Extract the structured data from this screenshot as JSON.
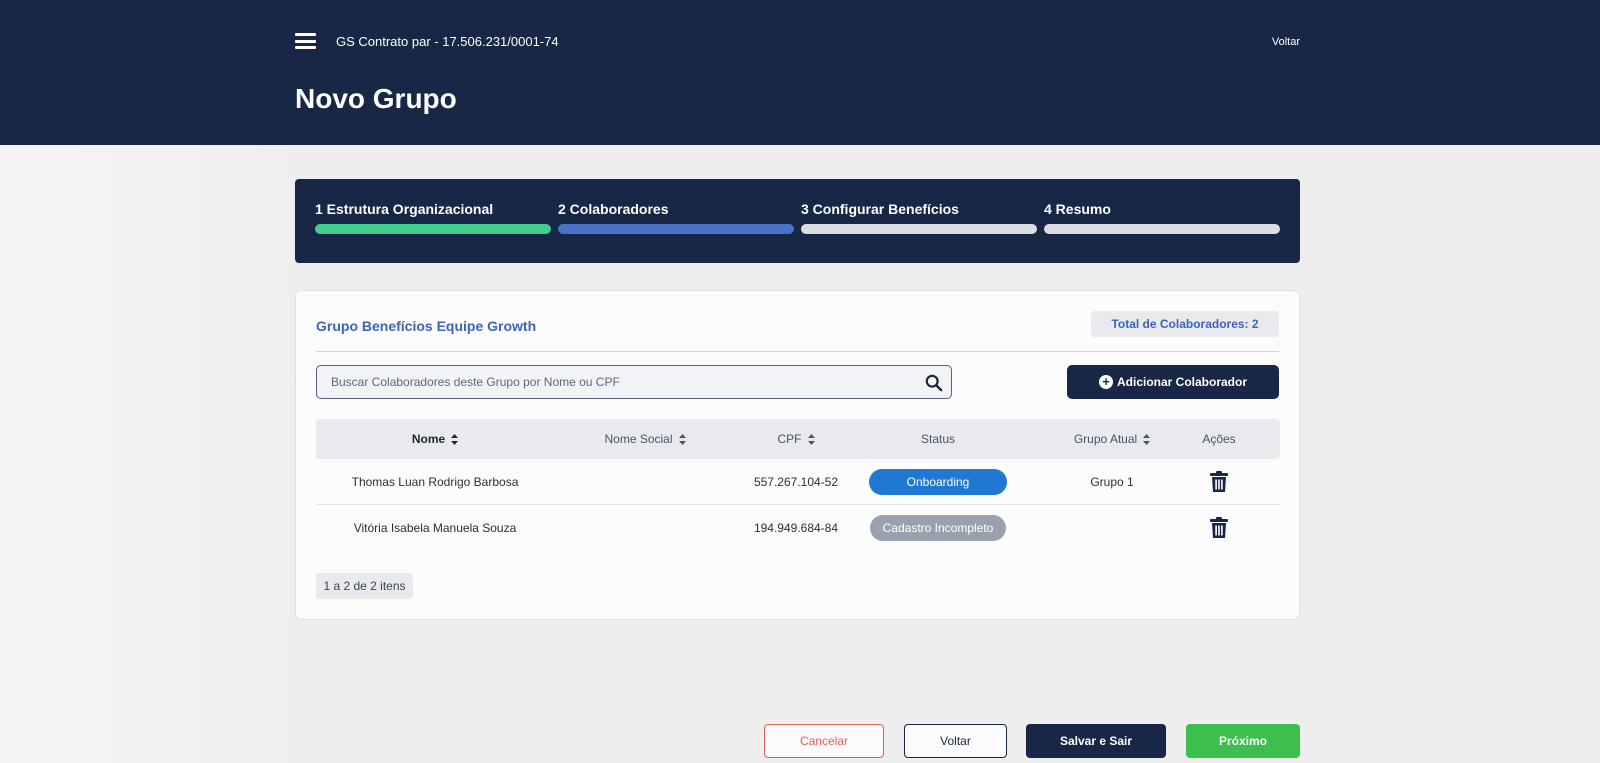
{
  "header": {
    "company": "GS Contrato par  -  17.506.231/0001-74",
    "back_link": "Voltar",
    "title": "Novo Grupo"
  },
  "stepper": {
    "steps": [
      {
        "label": "1 Estrutura Organizacional",
        "state": "done"
      },
      {
        "label": "2 Colaboradores",
        "state": "active"
      },
      {
        "label": "3 Configurar Benefícios",
        "state": "pending"
      },
      {
        "label": "4 Resumo",
        "state": "pending"
      }
    ]
  },
  "group": {
    "name": "Grupo Benefícios Equipe Growth",
    "total_label": "Total de Colaboradores: 2"
  },
  "search": {
    "placeholder": "Buscar Colaboradores deste Grupo por Nome ou CPF",
    "value": ""
  },
  "add_button": "Adicionar Colaborador",
  "table": {
    "columns": [
      "Nome",
      "Nome Social",
      "CPF",
      "Status",
      "Grupo Atual",
      "Ações"
    ],
    "rows": [
      {
        "nome": "Thomas Luan Rodrigo Barbosa",
        "nome_social": "",
        "cpf": "557.267.104-52",
        "status": "Onboarding",
        "grupo_atual": "Grupo 1"
      },
      {
        "nome": "Vitória Isabela Manuela Souza",
        "nome_social": "",
        "cpf": "194.949.684-84",
        "status": "Cadastro Incompleto",
        "grupo_atual": ""
      }
    ]
  },
  "pagination": "1 a 2 de 2 itens",
  "footer": {
    "cancel": "Cancelar",
    "back": "Voltar",
    "save_exit": "Salvar e Sair",
    "next": "Próximo"
  },
  "colors": {
    "navy": "#182746",
    "step_done": "#3fcf8c",
    "step_active": "#4a72c9",
    "status_onboarding": "#1f78d1",
    "status_incomplete": "#9aa1ae",
    "cancel": "#e45a56",
    "next": "#3dbf4f"
  },
  "icons": [
    "menu-icon",
    "search-icon",
    "plus-circle-icon",
    "sort-icon",
    "trash-icon"
  ]
}
